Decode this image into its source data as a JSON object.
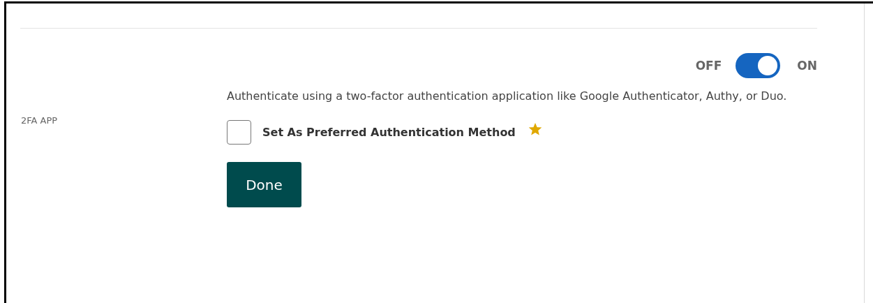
{
  "section": {
    "label": "2FA APP"
  },
  "toggle": {
    "off_label": "OFF",
    "on_label": "ON",
    "on": true
  },
  "description": "Authenticate using a two-factor authentication application like Google Authenticator, Authy, or Duo.",
  "preferred": {
    "label": "Set As Preferred Authentication Method",
    "checked": false
  },
  "buttons": [
    {
      "label": "Done"
    }
  ]
}
